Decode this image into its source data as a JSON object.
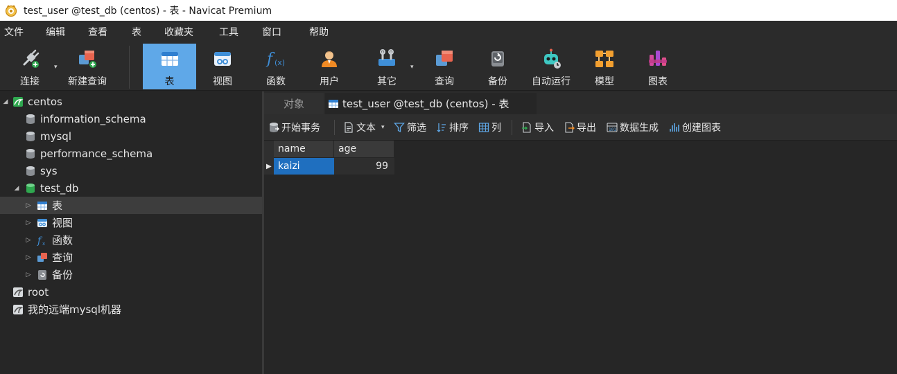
{
  "window": {
    "title": "test_user @test_db (centos) - 表 - Navicat Premium"
  },
  "menu": [
    "文件",
    "编辑",
    "查看",
    "表",
    "收藏夹",
    "工具",
    "窗口",
    "帮助"
  ],
  "toolbar": {
    "connect": "连接",
    "new_query": "新建查询",
    "table": "表",
    "view": "视图",
    "function": "函数",
    "user": "用户",
    "other": "其它",
    "query": "查询",
    "backup": "备份",
    "automation": "自动运行",
    "model": "模型",
    "chart": "图表",
    "active": "table"
  },
  "nav": {
    "connection": "centos",
    "databases": [
      "information_schema",
      "mysql",
      "performance_schema",
      "sys"
    ],
    "open_db": "test_db",
    "db_items": [
      "表",
      "视图",
      "函数",
      "查询",
      "备份"
    ],
    "other_connections": [
      "root",
      "我的远端mysql机器"
    ]
  },
  "tabs": {
    "objects": "对象",
    "current": "test_user @test_db (centos) - 表"
  },
  "object_toolbar": {
    "begin_transaction": "开始事务",
    "text": "文本",
    "filter": "筛选",
    "sort": "排序",
    "columns": "列",
    "import": "导入",
    "export": "导出",
    "data_generation": "数据生成",
    "create_chart": "创建图表"
  },
  "grid": {
    "columns": [
      "name",
      "age"
    ],
    "rows": [
      {
        "name": "kaizi",
        "age": "99"
      }
    ]
  },
  "colors": {
    "accent": "#5fa8e8",
    "selection": "#1f6fbf",
    "background": "#262626",
    "panel": "#2b2b2b"
  }
}
